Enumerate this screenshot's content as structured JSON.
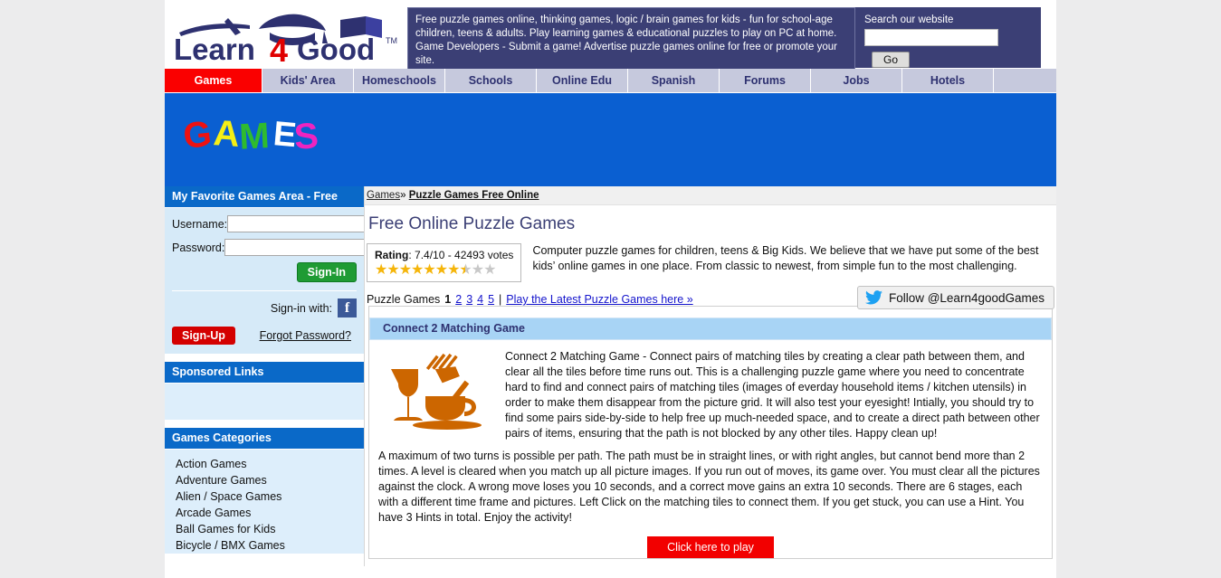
{
  "header": {
    "logo_text_1": "Learn",
    "logo_text_2": "4",
    "logo_text_3": "Good",
    "logo_tm": "TM",
    "tagline": "Free puzzle games online, thinking games, logic / brain games for kids - fun for school-age children, teens & adults. Play learning games & educational puzzles to play on PC at home. Game Developers - Submit a game! Advertise puzzle games online for free or promote your site.",
    "search_label": "Search our website",
    "search_value": "",
    "search_placeholder": "",
    "go_label": "Go"
  },
  "nav": {
    "items": [
      {
        "label": "Games",
        "active": true
      },
      {
        "label": "Kids' Area",
        "active": false
      },
      {
        "label": "Homeschools",
        "active": false
      },
      {
        "label": "Schools",
        "active": false
      },
      {
        "label": "Online Edu",
        "active": false
      },
      {
        "label": "Spanish",
        "active": false
      },
      {
        "label": "Forums",
        "active": false
      },
      {
        "label": "Jobs",
        "active": false
      },
      {
        "label": "Hotels",
        "active": false
      }
    ]
  },
  "banner": {
    "letters": [
      {
        "char": "G",
        "color": "#ee1111"
      },
      {
        "char": "A",
        "color": "#f5ef16"
      },
      {
        "char": "M",
        "color": "#2fbb2f"
      },
      {
        "char": "E",
        "color": "#ffffff"
      },
      {
        "char": "S",
        "color": "#ef24c0"
      }
    ],
    "background": "#0a5fd1"
  },
  "sidebar": {
    "login_panel_title": "My Favorite Games Area - Free",
    "username_label": "Username:",
    "username_value": "",
    "password_label": "Password:",
    "password_value": "",
    "signin_label": "Sign-In",
    "social_label": "Sign-in with:",
    "facebook_icon_letter": "f",
    "signup_label": "Sign-Up",
    "forgot_label": "Forgot Password?",
    "sponsored_title": "Sponsored Links",
    "categories_title": "Games Categories",
    "categories": [
      "Action Games",
      "Adventure Games",
      "Alien / Space Games",
      "Arcade Games",
      "Ball Games for Kids",
      "Bicycle / BMX Games"
    ]
  },
  "main": {
    "breadcrumb_root": "Games",
    "breadcrumb_sep": "»",
    "breadcrumb_current": "Puzzle Games Free Online",
    "page_title": "Free Online Puzzle Games",
    "rating_label": "Rating",
    "rating_value": "7.4/10 - 42493 votes",
    "intro_text": "Computer puzzle games for children, teens & Big Kids. We believe that we have put some of the best kids’ online games in one place. From classic to newest, from simple fun to the most challenging.",
    "pager_label": "Puzzle Games",
    "pager_current": "1",
    "pager_pages": [
      "2",
      "3",
      "4",
      "5"
    ],
    "pager_divider": "|",
    "latest_link": "Play the Latest Puzzle Games here »",
    "twitter_label": "Follow @Learn4goodGames",
    "game_title": "Connect 2 Matching Game",
    "game_desc_1": "Connect 2 Matching Game - Connect pairs of matching tiles by creating a clear path between them, and clear all the tiles before time runs out. This is a challenging puzzle game where you need to concentrate hard to find and connect pairs of matching tiles (images of everday household items / kitchen utensils) in order to make them disappear from the picture grid. It will also test your eyesight! Intially, you should try to find some pairs side-by-side to help free up much-needed space, and to create a direct path between other pairs of items, ensuring that the path is not blocked by any other tiles. Happy clean up!",
    "game_desc_2": "A maximum of two turns is possible per path. The path must be in straight lines, or with right angles, but cannot bend more than 2 times. A level is cleared when you match up all picture images. If you run out of moves, its game over. You must clear all the pictures against the clock. A wrong move loses you 10 seconds, and a correct move gains an extra 10 seconds. There are 6 stages, each with a different time frame and pictures. Left Click on the matching tiles to connect them. If you get stuck, you can use a Hint. You have 3 Hints in total. Enjoy the activity!",
    "play_label": "Click here to play"
  },
  "colors": {
    "brand_navy": "#3b3f75",
    "nav_active": "#fa0000",
    "banner_blue": "#0a5fd1",
    "panel_blue": "#0a69c8",
    "thumb_orange": "#cc6600",
    "star_on": "#f5b50a",
    "star_off": "#c8c8c8"
  }
}
